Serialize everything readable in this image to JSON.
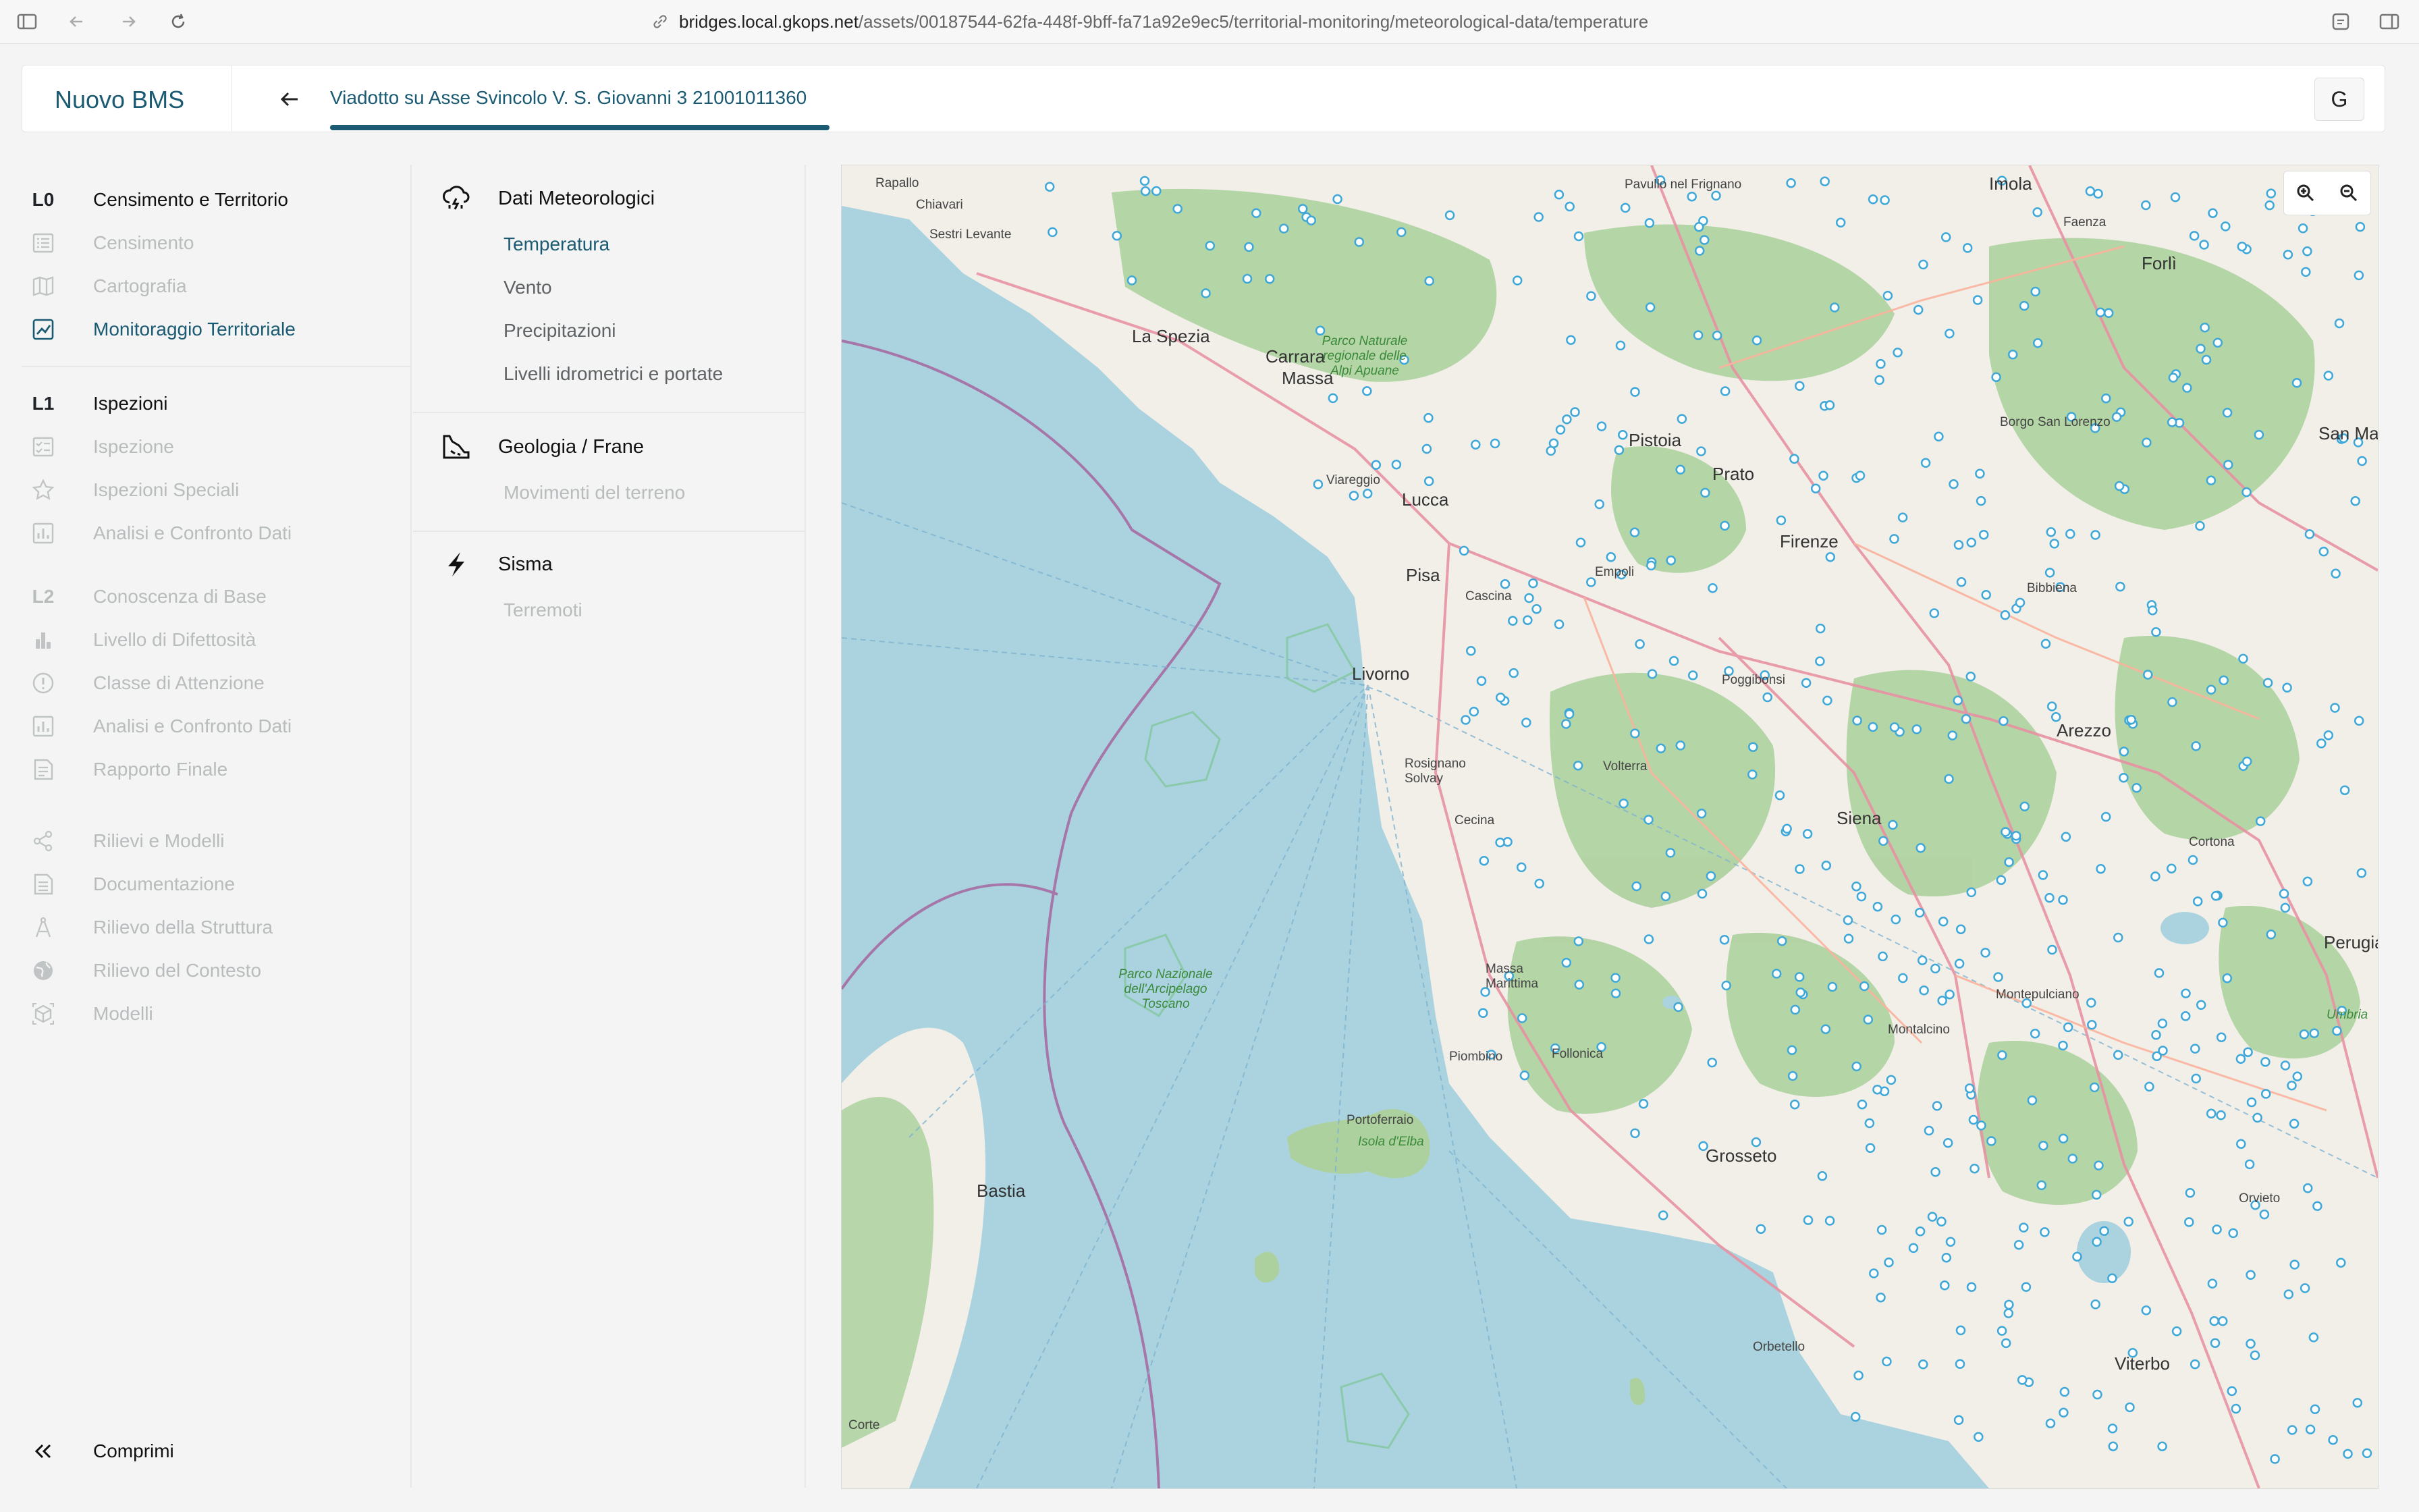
{
  "browser": {
    "url_host": "bridges.local.gkops.net",
    "url_path": "/assets/00187544-62fa-448f-9bff-fa71a92e9ec5/territorial-monitoring/meteorological-data/temperature"
  },
  "header": {
    "brand": "Nuovo BMS",
    "asset_title": "Viadotto su Asse Svincolo V. S. Giovanni 3 21001011360",
    "user_initial": "G"
  },
  "sidebar": {
    "l0": {
      "badge": "L0",
      "label": "Censimento e Territorio"
    },
    "l0_items": [
      {
        "label": "Censimento",
        "icon": "list-icon"
      },
      {
        "label": "Cartografia",
        "icon": "map-icon"
      },
      {
        "label": "Monitoraggio Territoriale",
        "icon": "chart-line-icon"
      }
    ],
    "l1": {
      "badge": "L1",
      "label": "Ispezioni"
    },
    "l1_items": [
      {
        "label": "Ispezione",
        "icon": "checklist-icon"
      },
      {
        "label": "Ispezioni Speciali",
        "icon": "star-icon"
      },
      {
        "label": "Analisi e Confronto Dati",
        "icon": "bar-chart-icon"
      }
    ],
    "l2": {
      "badge": "L2",
      "label": "Conoscenza di Base"
    },
    "l2_items": [
      {
        "label": "Livello di Difettosità",
        "icon": "bars-icon"
      },
      {
        "label": "Classe di Attenzione",
        "icon": "alert-circle-icon"
      },
      {
        "label": "Analisi e Confronto Dati",
        "icon": "bar-chart-icon"
      },
      {
        "label": "Rapporto Finale",
        "icon": "report-icon"
      }
    ],
    "other_items": [
      {
        "label": "Rilievi e Modelli",
        "icon": "share-icon"
      },
      {
        "label": "Documentazione",
        "icon": "document-icon"
      },
      {
        "label": "Rilievo della Struttura",
        "icon": "compass-icon"
      },
      {
        "label": "Rilievo del Contesto",
        "icon": "globe-icon"
      },
      {
        "label": "Modelli",
        "icon": "cube-icon"
      }
    ],
    "collapse_label": "Comprimi"
  },
  "submenu": {
    "meteo": {
      "title": "Dati Meteorologici",
      "items": [
        "Temperatura",
        "Vento",
        "Precipitazioni",
        "Livelli idrometrici e portate"
      ]
    },
    "geo": {
      "title": "Geologia / Frane",
      "items": [
        "Movimenti del terreno"
      ]
    },
    "sisma": {
      "title": "Sisma",
      "items": [
        "Terremoti"
      ]
    }
  },
  "map": {
    "labels": {
      "rapallo": "Rapallo",
      "chiavari": "Chiavari",
      "sestri": "Sestri Levante",
      "laspezia": "La Spezia",
      "carrara": "Carrara",
      "massa": "Massa",
      "viareggio": "Viareggio",
      "lucca": "Lucca",
      "pisa": "Pisa",
      "livorno": "Livorno",
      "pistoia": "Pistoia",
      "prato": "Prato",
      "firenze": "Firenze",
      "empoli": "Empoli",
      "siena": "Siena",
      "arezzo": "Arezzo",
      "grosseto": "Grosseto",
      "piombino": "Piombino",
      "follonica": "Follonica",
      "orbetello": "Orbetello",
      "viterbo": "Viterbo",
      "perugia": "Perugia",
      "bastia": "Bastia",
      "corte": "Corte",
      "imola": "Imola",
      "faenza": "Faenza",
      "forli": "Forlì",
      "sanmarino": "San Marin",
      "cecina": "Cecina",
      "poggibonsi": "Poggibonsi",
      "montepulciano": "Montepulciano",
      "elba": "Isola d'Elba",
      "portoferraio": "Portoferraio",
      "parco_arcipelago": "Parco Nazionale dell'Arcipelago Toscano",
      "parco_apuane": "Parco Naturale regionale delle Alpi Apuane",
      "orvieto": "Orvieto",
      "cortona": "Cortona",
      "bibbiena": "Bibbiena",
      "volterra": "Volterra",
      "borgo": "Borgo San Lorenzo",
      "rosignano": "Rosignano Solvay",
      "pontremoli": "Pavullo nel Frignano",
      "umbria": "Umbria",
      "massa_m": "Massa Marittima",
      "cascina": "Cascina",
      "montalcino": "Montalcino"
    }
  },
  "colors": {
    "accent": "#1a5a72",
    "sea": "#aad3df",
    "land": "#f2efe9",
    "forest": "#add19e",
    "station": "#3fa8d8"
  }
}
